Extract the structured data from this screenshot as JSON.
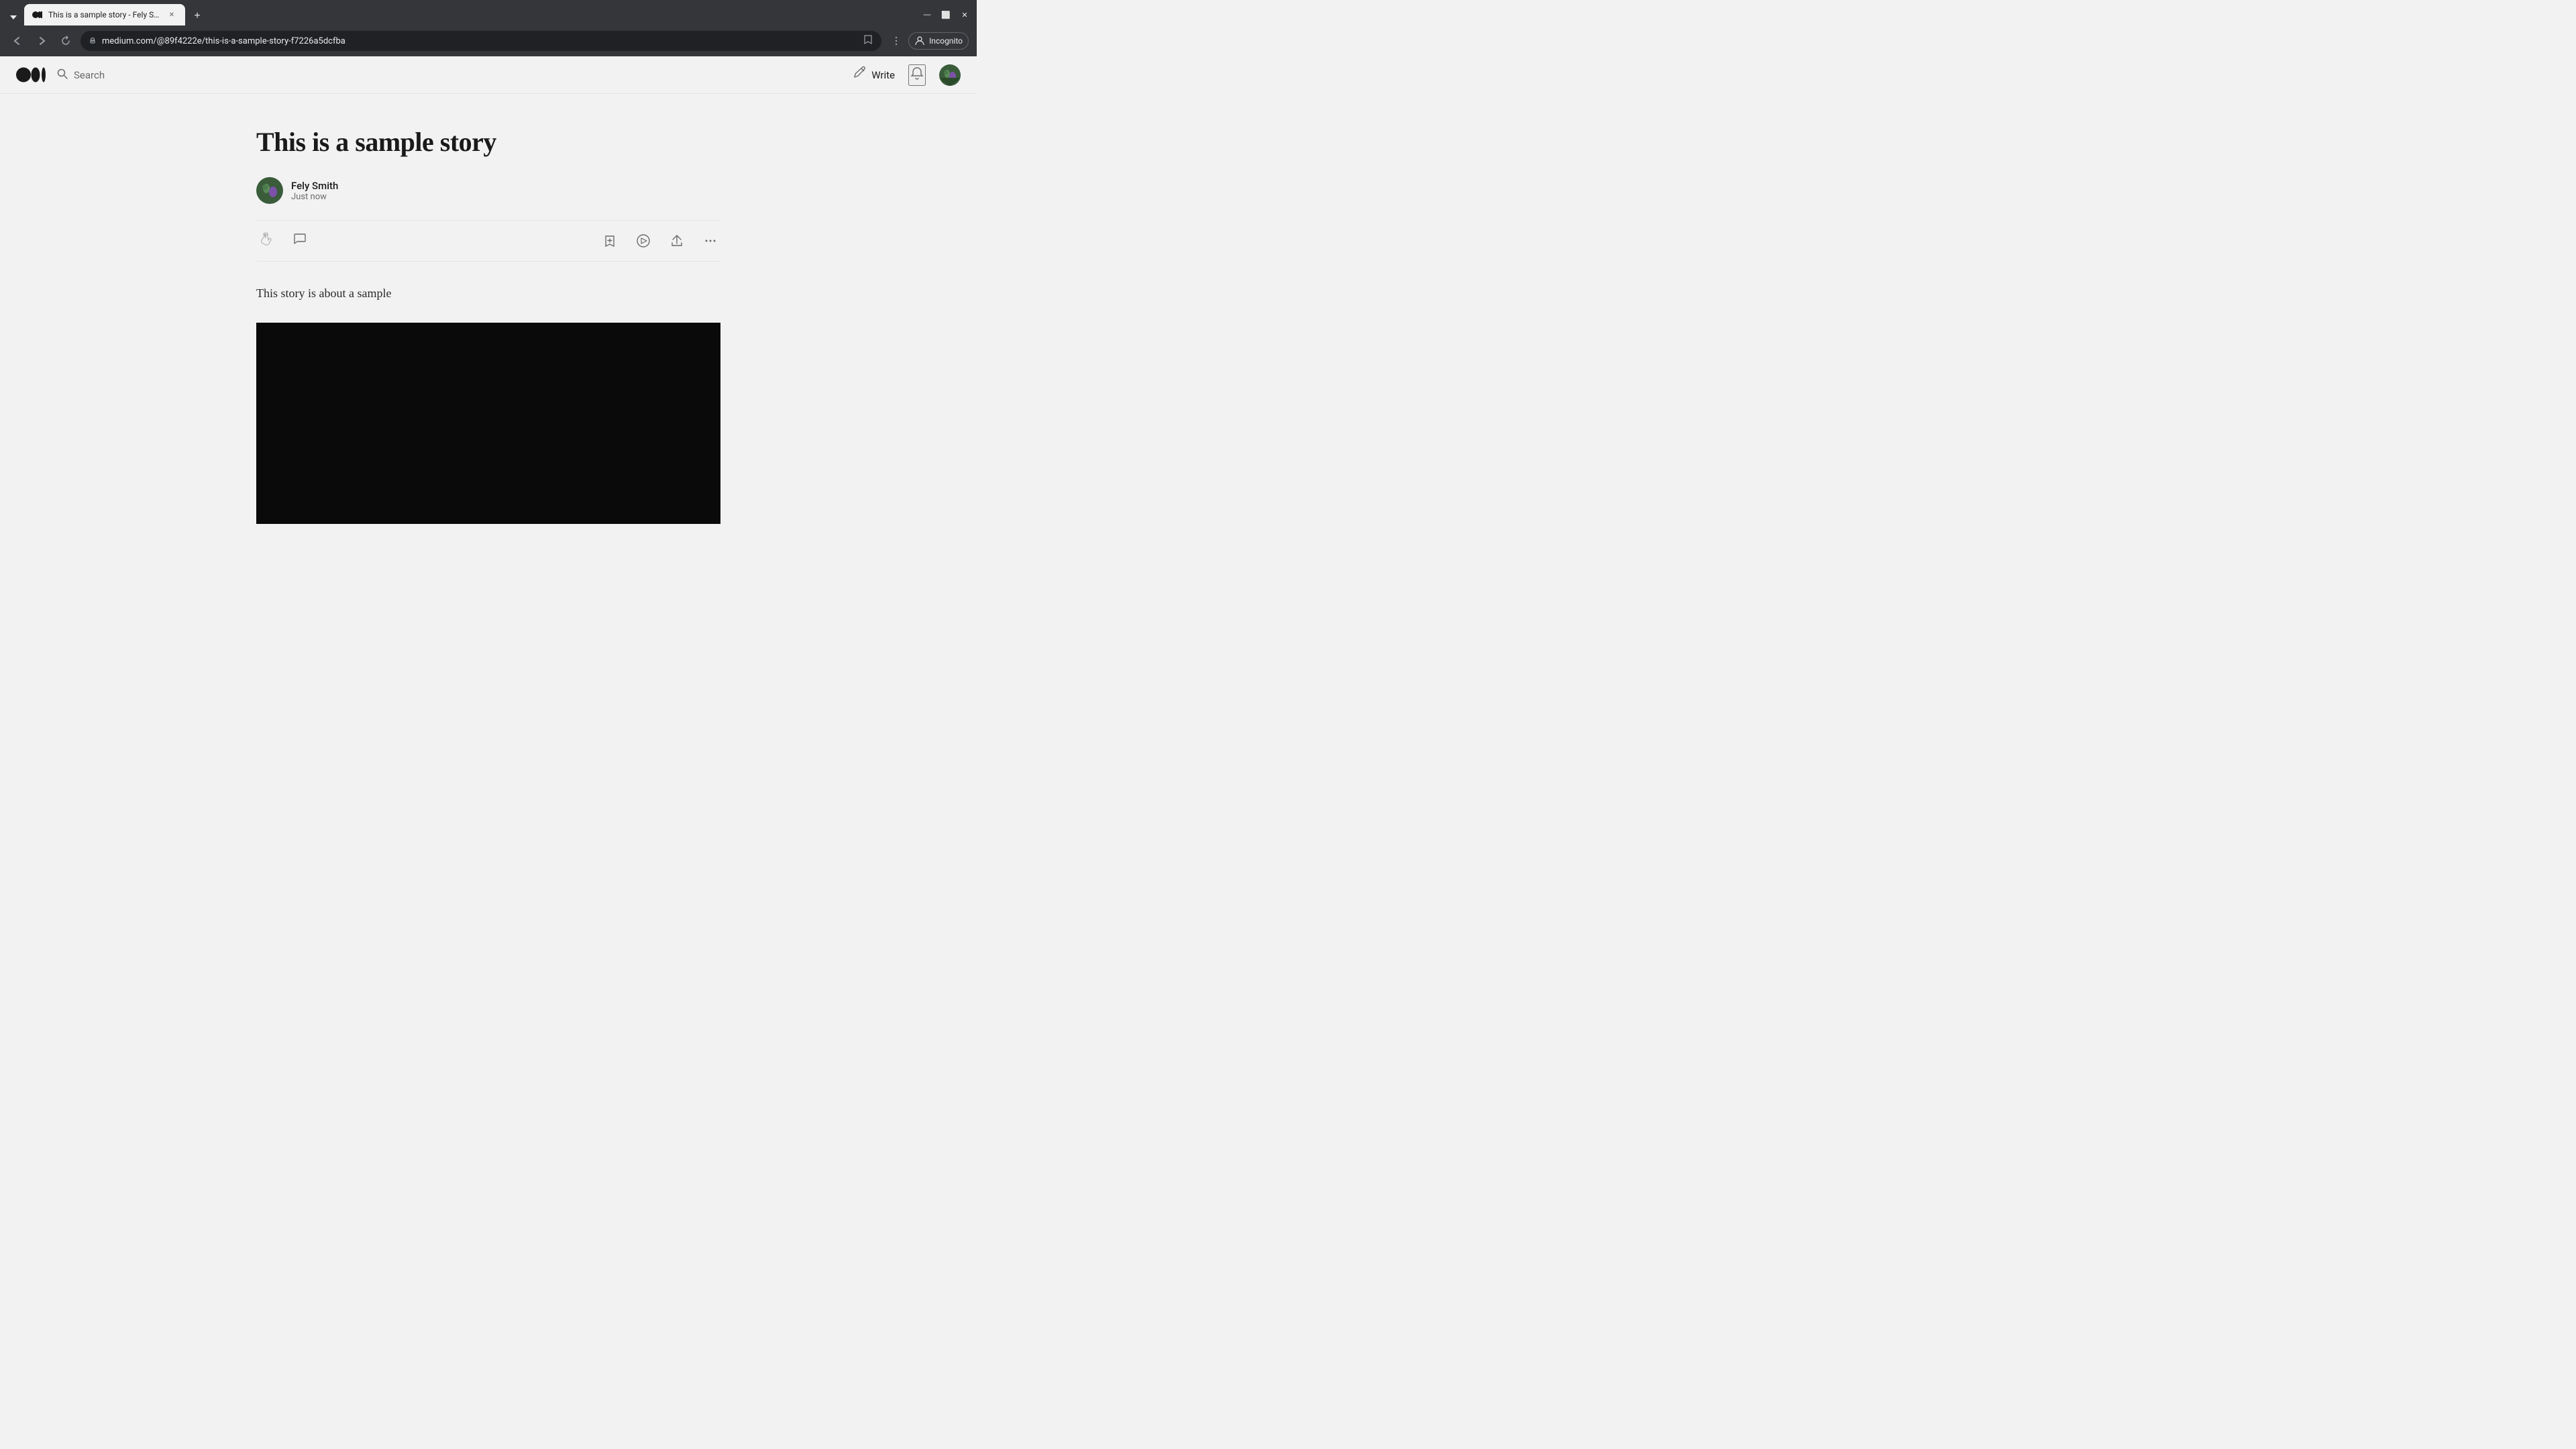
{
  "browser": {
    "tab": {
      "title": "This is a sample story - Fely Sm…",
      "favicon": "M"
    },
    "address": "medium.com/@89f4222e/this-is-a-sample-story-f7226a5dcfba",
    "incognito_label": "Incognito",
    "new_tab_label": "+"
  },
  "nav": {
    "search_placeholder": "Search",
    "write_label": "Write",
    "notification_icon": "🔔"
  },
  "story": {
    "title": "This is a sample story",
    "author_name": "Fely Smith",
    "author_time": "Just now",
    "body": "This story is about a sample"
  },
  "actions": {
    "clap": "👏",
    "comment": "💬",
    "save": "＋",
    "listen": "▶",
    "share": "⬆",
    "more": "•••"
  }
}
